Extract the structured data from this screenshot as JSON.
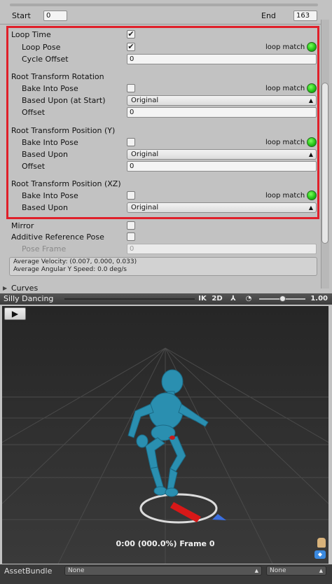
{
  "range": {
    "start_label": "Start",
    "start_value": "0",
    "end_label": "End",
    "end_value": "163"
  },
  "loop_time": {
    "label": "Loop Time",
    "checked": true
  },
  "loop_pose": {
    "label": "Loop Pose",
    "checked": true,
    "match_label": "loop match"
  },
  "cycle_offset": {
    "label": "Cycle Offset",
    "value": "0"
  },
  "root_rotation": {
    "heading": "Root Transform Rotation",
    "bake_label": "Bake Into Pose",
    "match_label": "loop match",
    "based_upon_label": "Based Upon (at Start)",
    "based_upon_value": "Original",
    "offset_label": "Offset",
    "offset_value": "0"
  },
  "root_position_y": {
    "heading": "Root Transform Position (Y)",
    "bake_label": "Bake Into Pose",
    "match_label": "loop match",
    "based_upon_label": "Based Upon",
    "based_upon_value": "Original",
    "offset_label": "Offset",
    "offset_value": "0"
  },
  "root_position_xz": {
    "heading": "Root Transform Position (XZ)",
    "bake_label": "Bake Into Pose",
    "match_label": "loop match",
    "based_upon_label": "Based Upon",
    "based_upon_value": "Original"
  },
  "mirror": {
    "label": "Mirror"
  },
  "additive": {
    "label": "Additive Reference Pose"
  },
  "pose_frame": {
    "label": "Pose Frame",
    "value": "0"
  },
  "stats": {
    "velocity": "Average Velocity: (0.007, 0.000, 0.033)",
    "angular": "Average Angular Y Speed: 0.0 deg/s"
  },
  "curves": {
    "label": "Curves"
  },
  "preview_bar": {
    "title": "Silly Dancing",
    "ik": "IK",
    "twod": "2D",
    "speed": "1.00",
    "speed_slider_fraction": 0.55
  },
  "preview": {
    "frame_text": "0:00 (000.0%) Frame 0"
  },
  "asset_bundle": {
    "label": "AssetBundle",
    "value1": "None",
    "value2": "None"
  },
  "colors": {
    "highlight": "#e0202a",
    "match_green": "#1fbf14",
    "character": "#2a8fb0"
  }
}
